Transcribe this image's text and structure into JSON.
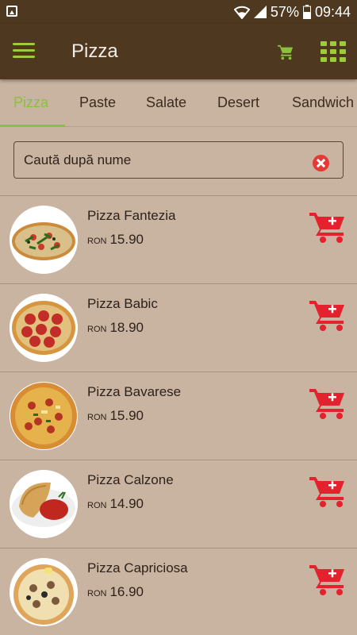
{
  "status": {
    "battery": "57%",
    "time": "09:44"
  },
  "app": {
    "title": "Pizza"
  },
  "tabs": [
    "Pizza",
    "Paste",
    "Salate",
    "Desert",
    "Sandwich"
  ],
  "search": {
    "placeholder": "Caută după nume"
  },
  "products": [
    {
      "name": "Pizza Fantezia",
      "currency": "RON",
      "price": "15.90"
    },
    {
      "name": "Pizza Babic",
      "currency": "RON",
      "price": "18.90"
    },
    {
      "name": "Pizza Bavarese",
      "currency": "RON",
      "price": "15.90"
    },
    {
      "name": "Pizza Calzone",
      "currency": "RON",
      "price": "14.90"
    },
    {
      "name": "Pizza Capriciosa",
      "currency": "RON",
      "price": "16.90"
    }
  ],
  "icons": {
    "menu": "hamburger-menu-icon",
    "cart": "shopping-cart-icon",
    "grid": "grid-view-icon",
    "clear": "clear-search-icon",
    "add": "add-to-cart-icon"
  },
  "colors": {
    "background": "#c9b4a2",
    "header": "#4e3820",
    "accent": "#8bc13a",
    "add": "#e3222d"
  }
}
